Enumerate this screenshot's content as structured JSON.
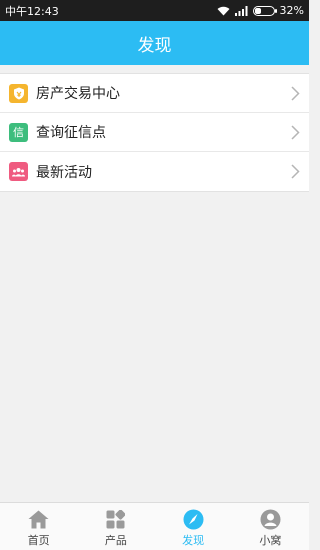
{
  "status_bar": {
    "time": "中午12:43",
    "battery": "32%"
  },
  "header": {
    "title": "发现"
  },
  "list": {
    "items": [
      {
        "label": "房产交易中心",
        "icon": "shield-icon",
        "color": "#f5b52e"
      },
      {
        "label": "查询征信点",
        "icon_text": "信",
        "icon": "credit-icon",
        "color": "#3dbd7d"
      },
      {
        "label": "最新活动",
        "icon": "people-icon",
        "color": "#ef5b80"
      }
    ]
  },
  "tabbar": {
    "tabs": [
      {
        "label": "首页",
        "icon": "home-icon"
      },
      {
        "label": "产品",
        "icon": "grid-icon"
      },
      {
        "label": "发现",
        "icon": "compass-icon",
        "active": true
      },
      {
        "label": "小窝",
        "icon": "user-icon"
      }
    ]
  },
  "colors": {
    "accent": "#2cbcf3",
    "status_bar": "#1e1e1e"
  }
}
